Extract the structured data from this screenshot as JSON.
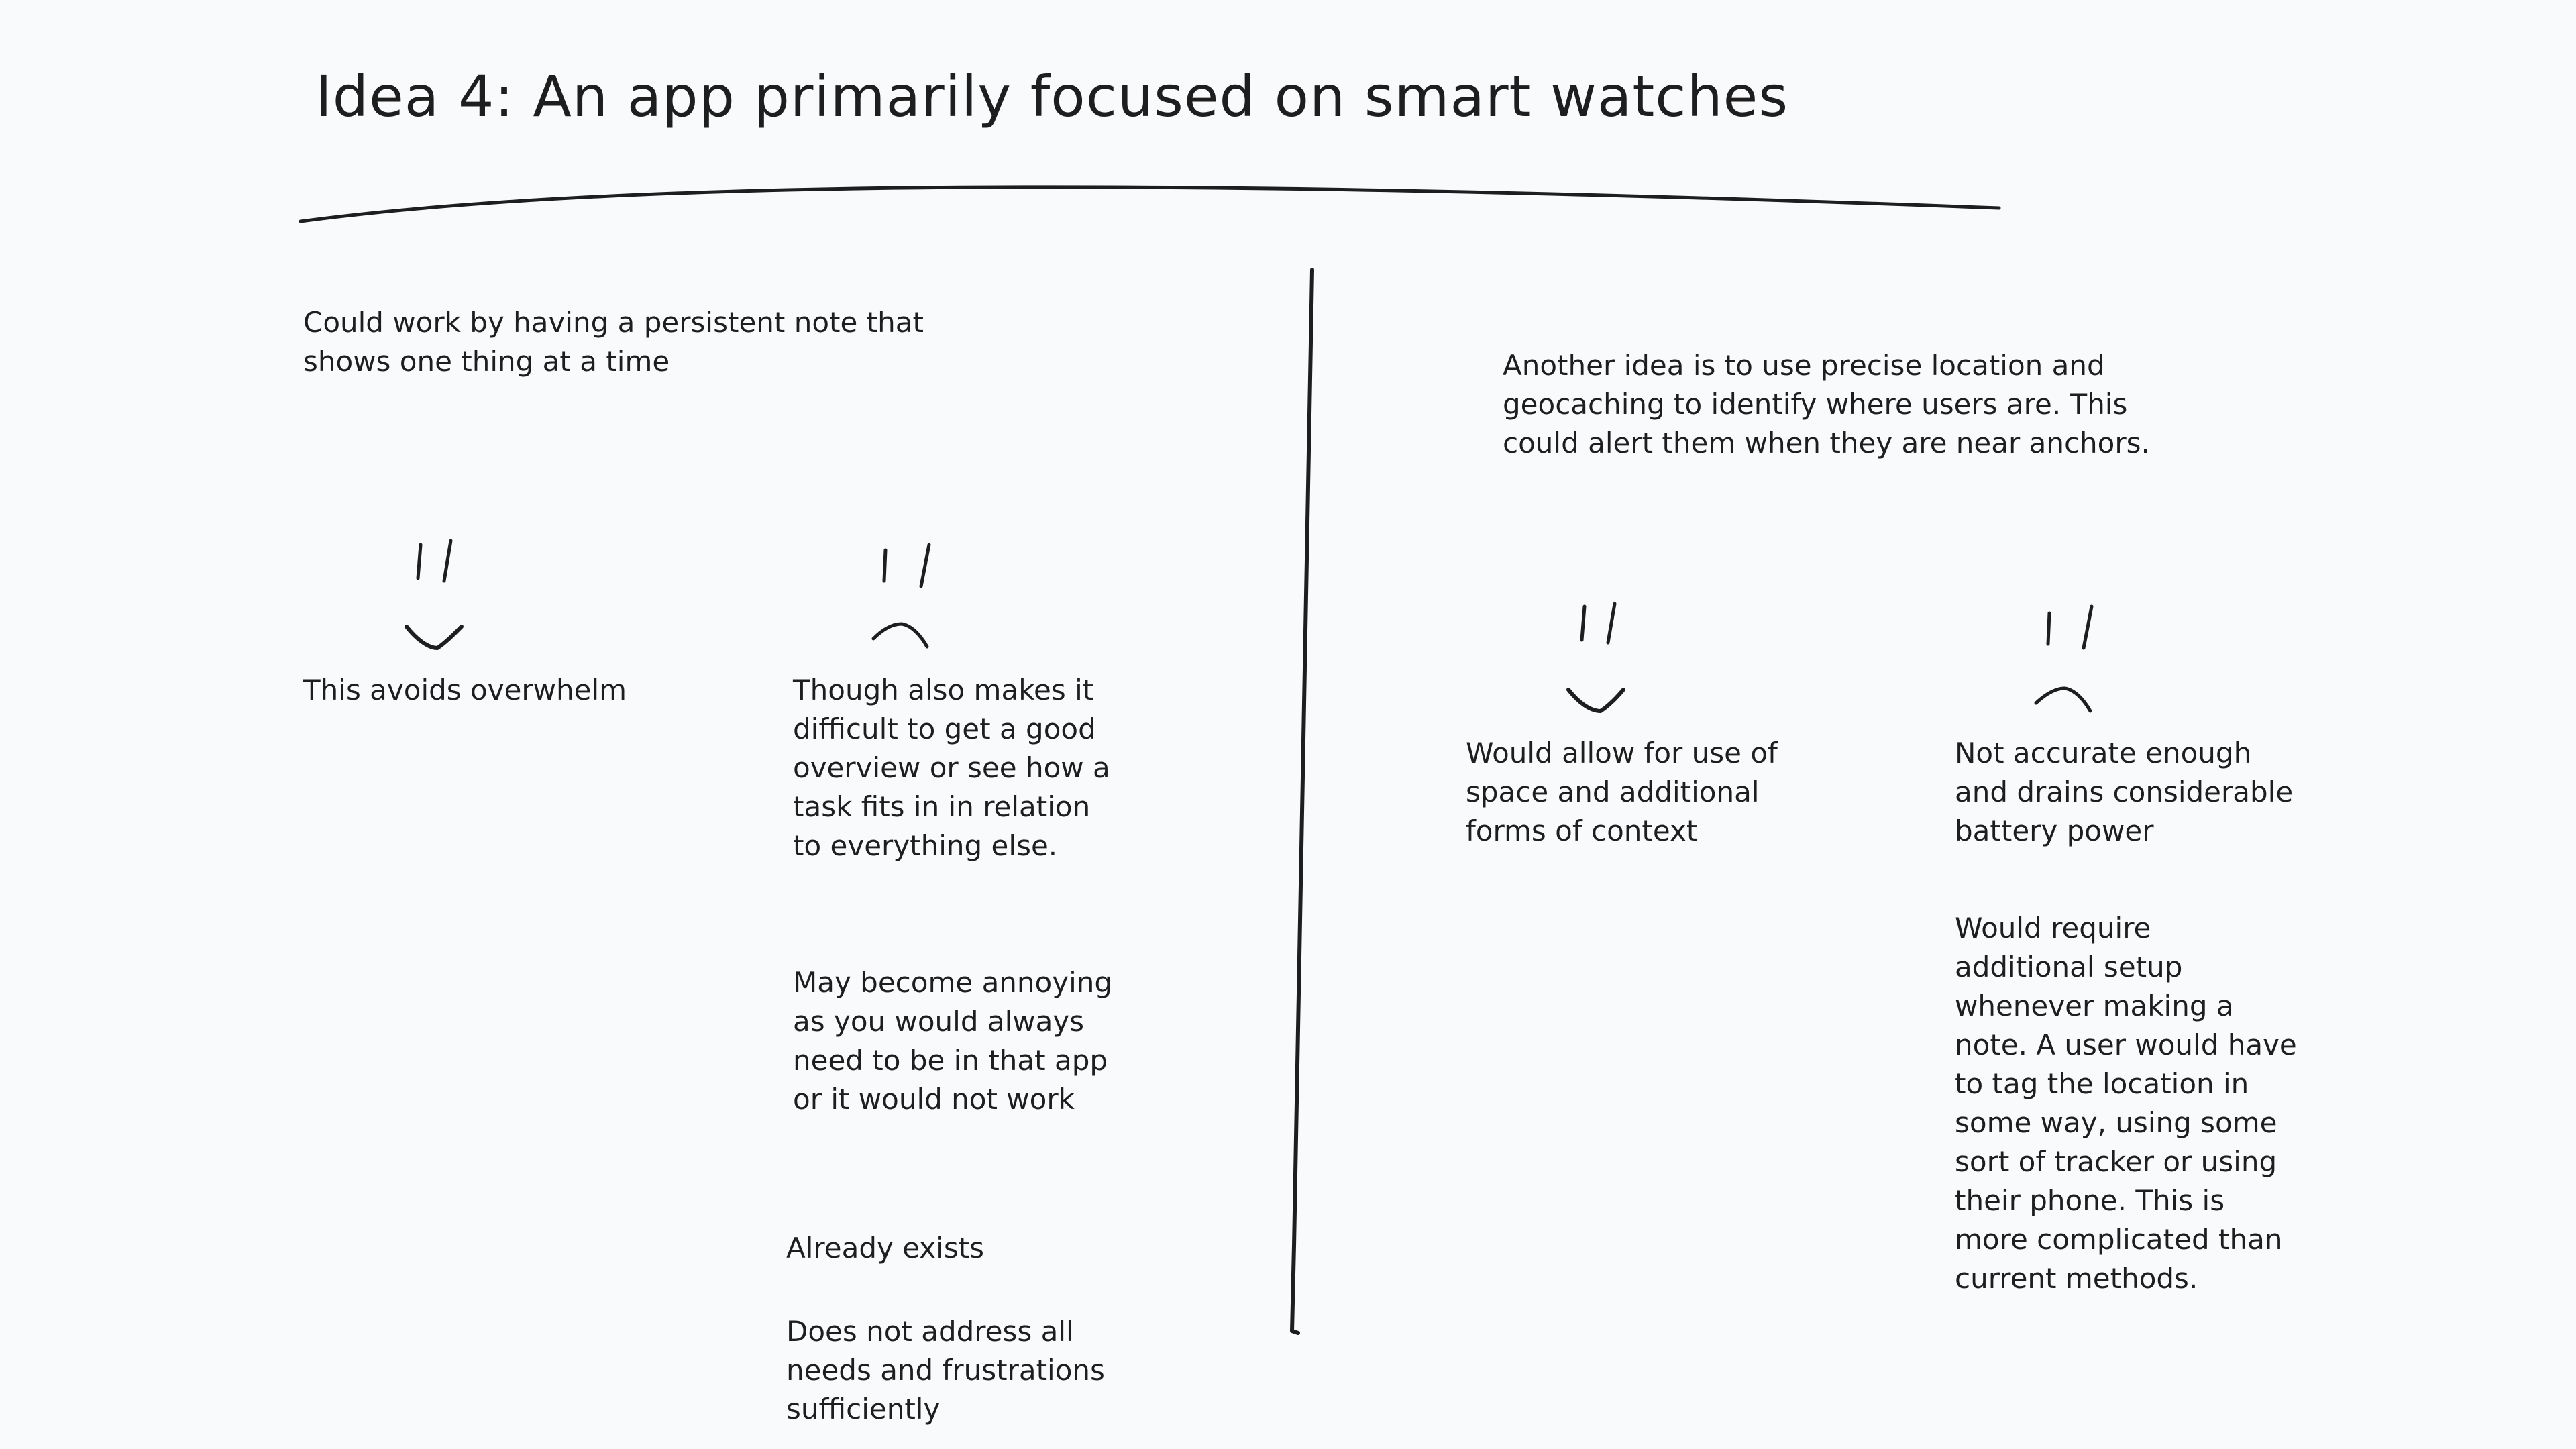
{
  "title": "Idea 4: An app primarily focused on smart watches",
  "left": {
    "intro": "Could work by having a persistent note that\nshows one thing at a time",
    "pro": "This avoids overwhelm",
    "cons": [
      "Though also makes it\ndifficult to get a good\noverview or see how a\ntask fits in in relation\nto everything else.",
      "May become annoying\nas you would always\nneed to be in that app\nor it would not work",
      "Already exists",
      "Does not address all\nneeds and frustrations\nsufficiently"
    ]
  },
  "right": {
    "intro": "Another idea is to use precise location and\ngeocaching to identify where users are. This\ncould alert them when they are near anchors.",
    "pro": "Would allow for use of\nspace and additional\nforms of context",
    "cons": [
      "Not accurate enough\nand drains considerable\nbattery power",
      "Would require\nadditional setup\nwhenever making a\nnote. A user would have\nto tag the location in\nsome way, using some\nsort of tracker or using\ntheir phone. This is\nmore complicated than\ncurrent methods."
    ]
  },
  "icons": [
    "happy-face-icon",
    "sad-face-icon"
  ],
  "colors": {
    "background": "#f9fafc",
    "ink": "#1e1e1e"
  }
}
